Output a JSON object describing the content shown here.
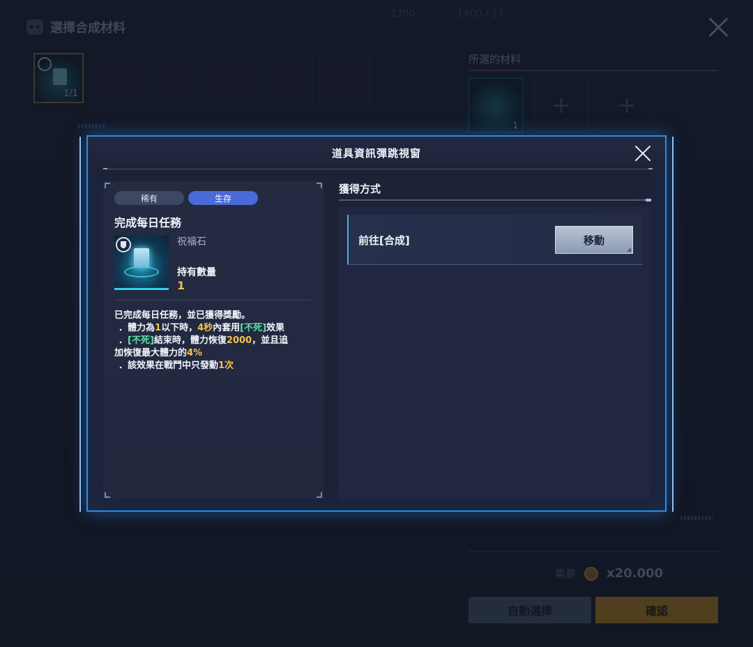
{
  "background": {
    "title": "選擇合成材料",
    "top_icons": [
      "1700",
      "1400 / 27"
    ],
    "slots": [
      {
        "filled": true,
        "count": "1/1"
      },
      {
        "filled": false
      },
      {
        "filled": false
      },
      {
        "filled": false
      },
      {
        "filled": false
      },
      {
        "filled": false
      }
    ],
    "selected_materials_label": "所選的材料",
    "selected_slots": [
      {
        "filled": true,
        "count": "1"
      },
      {
        "filled": false,
        "plus": "+"
      },
      {
        "filled": false,
        "plus": "+"
      }
    ],
    "need_label": "需要",
    "need_amount": "x20.000",
    "auto_select_label": "自動選擇",
    "confirm_label": "確認"
  },
  "popup": {
    "title": "道具資訊彈跳視窗",
    "tags": [
      "稀有",
      "生存"
    ],
    "item_name": "完成每日任務",
    "item_subname": "祝福石",
    "qty_label": "持有數量",
    "qty_value": "1",
    "description": {
      "line1": "已完成每日任務，並已獲得獎勵。",
      "line2": {
        "a": "．體力為",
        "b": "1",
        "c": "以下時，",
        "d": "4秒",
        "e": "內套用",
        "f": "[不死]",
        "g": "效果"
      },
      "line3": {
        "a": "．",
        "b": "[不死]",
        "c": "結束時，體力恢復",
        "d": "2000",
        "e": "，並且追"
      },
      "line4": {
        "a": "加恢復最大體力的",
        "b": "4%"
      },
      "line5": {
        "a": "．該效果在戰鬥中只發動",
        "b": "1次"
      }
    },
    "acquire_title": "獲得方式",
    "routes": [
      {
        "label": "前往[合成]",
        "button": "移動"
      }
    ]
  },
  "colors": {
    "accent_blue": "#2f8de0",
    "highlight_yellow": "#f3c24a",
    "highlight_green": "#5fe3a6",
    "tag_survive": "#4a6ad8"
  }
}
